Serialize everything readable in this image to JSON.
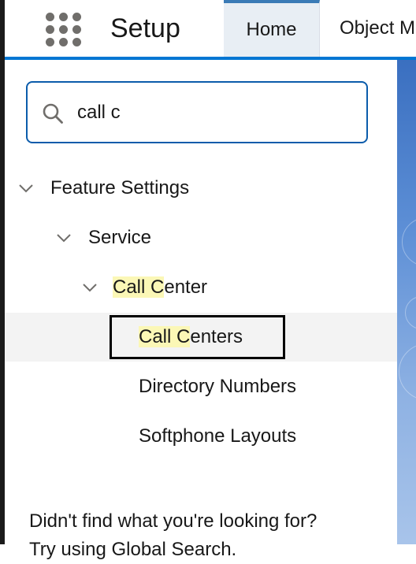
{
  "header": {
    "app_launcher_icon": "app-launcher-grid-icon",
    "title": "Setup",
    "tabs": [
      {
        "label": "Home",
        "active": true
      },
      {
        "label": "Object M",
        "active": false
      }
    ],
    "accent_color": "#0176d3"
  },
  "search": {
    "icon": "search-icon",
    "value": "call c"
  },
  "tree": {
    "feature_settings": "Feature Settings",
    "service": "Service",
    "call_center": {
      "match": "Call C",
      "rest": "enter"
    },
    "call_centers": {
      "match": "Call C",
      "rest": "enters"
    },
    "directory_numbers": "Directory Numbers",
    "softphone_layouts": "Softphone Layouts",
    "highlight_color": "#fbf7b6"
  },
  "footer": {
    "not_found": "Didn't find what you're looking for?",
    "global_search": "Try using Global Search."
  }
}
